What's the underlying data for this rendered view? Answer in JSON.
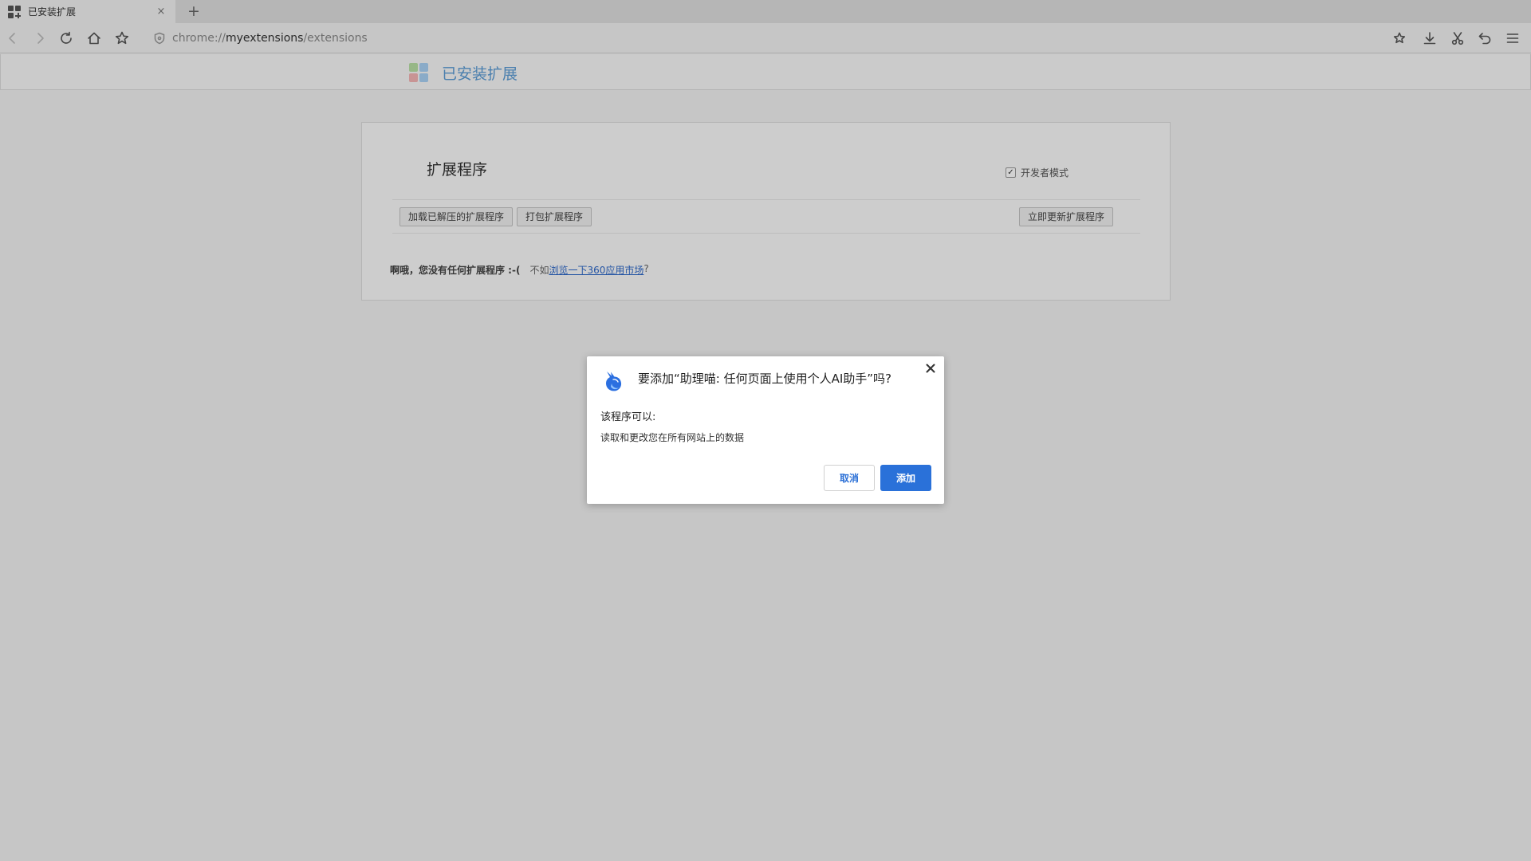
{
  "browser": {
    "tab_title": "已安装扩展",
    "tab_close": "×",
    "new_tab": "+",
    "url_scheme": "chrome://",
    "url_host": "myextensions",
    "url_path": "/extensions"
  },
  "header": {
    "title": "已安装扩展",
    "logo_colors": [
      "#b9e0a5",
      "#a9d1f5",
      "#f5b5b5",
      "#a9d1f5"
    ]
  },
  "extensions_page": {
    "section_title": "扩展程序",
    "developer_mode_label": "开发者模式",
    "developer_mode_checked": true,
    "load_unpacked_label": "加载已解压的扩展程序",
    "pack_label": "打包扩展程序",
    "update_now_label": "立即更新扩展程序",
    "empty_message": "啊哦，您没有任何扩展程序 :-(",
    "browse_prefix": "不如",
    "browse_link": "浏览一下360应用市场",
    "browse_suffix": "?"
  },
  "dialog": {
    "title": "要添加“助理喵: 任何页面上使用个人AI助手”吗?",
    "subtitle": "该程序可以:",
    "permission": "读取和更改您在所有网站上的数据",
    "cancel_label": "取消",
    "add_label": "添加",
    "accent_color": "#2a71d9"
  }
}
